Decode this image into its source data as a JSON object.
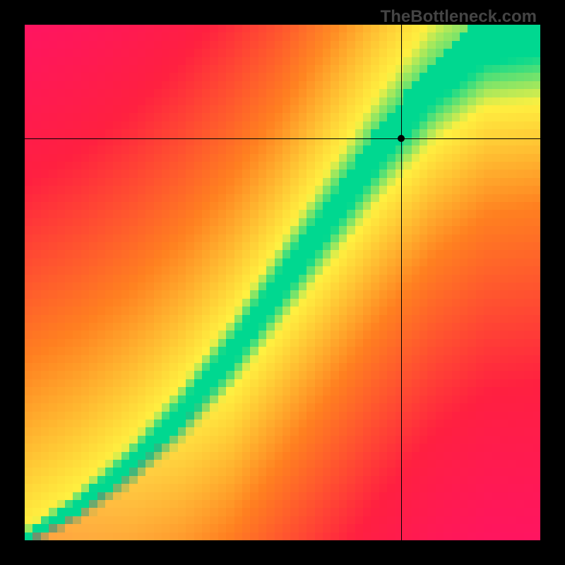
{
  "watermark": "TheBottleneck.com",
  "chart_data": {
    "type": "heatmap",
    "title": "",
    "xlabel": "",
    "ylabel": "",
    "x_range": [
      0,
      100
    ],
    "y_range": [
      0,
      100
    ],
    "grid_size": 64,
    "crosshair": {
      "x": 73,
      "y": 22
    },
    "marker": {
      "x": 73,
      "y": 22
    },
    "optimal_curve": {
      "description": "Green optimal curve from bottom-left to top-right, curving upward",
      "points": [
        {
          "x": 0,
          "y": 100
        },
        {
          "x": 10,
          "y": 94
        },
        {
          "x": 20,
          "y": 86
        },
        {
          "x": 30,
          "y": 76
        },
        {
          "x": 40,
          "y": 64
        },
        {
          "x": 50,
          "y": 50
        },
        {
          "x": 60,
          "y": 36
        },
        {
          "x": 70,
          "y": 22
        },
        {
          "x": 80,
          "y": 10
        },
        {
          "x": 90,
          "y": 2
        },
        {
          "x": 100,
          "y": 0
        }
      ]
    },
    "colors": {
      "optimal": "#00D084",
      "near_optimal": "#FFEB3B",
      "warning": "#FF9800",
      "bad": "#F44336",
      "worst": "#E91E63"
    }
  }
}
